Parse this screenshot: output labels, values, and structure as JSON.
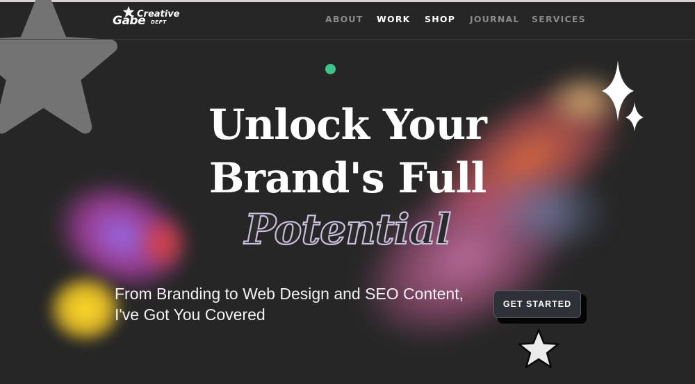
{
  "brand": {
    "logo_word": "Gabe",
    "logo_subword": "Creative",
    "logo_dept": "DEPT"
  },
  "nav": {
    "items": [
      {
        "label": "ABOUT",
        "active": false
      },
      {
        "label": "WORK",
        "active": true
      },
      {
        "label": "SHOP",
        "active": true
      },
      {
        "label": "JOURNAL",
        "active": false
      },
      {
        "label": "SERVICES",
        "active": false
      }
    ]
  },
  "hero": {
    "headline_line1": "Unlock Your",
    "headline_line2": "Brand's Full",
    "headline_line3": "Potential",
    "subtitle": "From Branding to Web Design and SEO Content, I've Got You Covered",
    "cta_label": "GET STARTED"
  },
  "icons": {
    "decor_big_star": "star-icon",
    "decor_small_star": "star-icon",
    "decor_sparkles": "sparkle-icon",
    "decor_dot": "dot-icon"
  },
  "colors": {
    "background": "#262626",
    "accent_green": "#3cc48b",
    "outline_purple": "#c9c0dc",
    "cta_bg": "#2e3138"
  }
}
